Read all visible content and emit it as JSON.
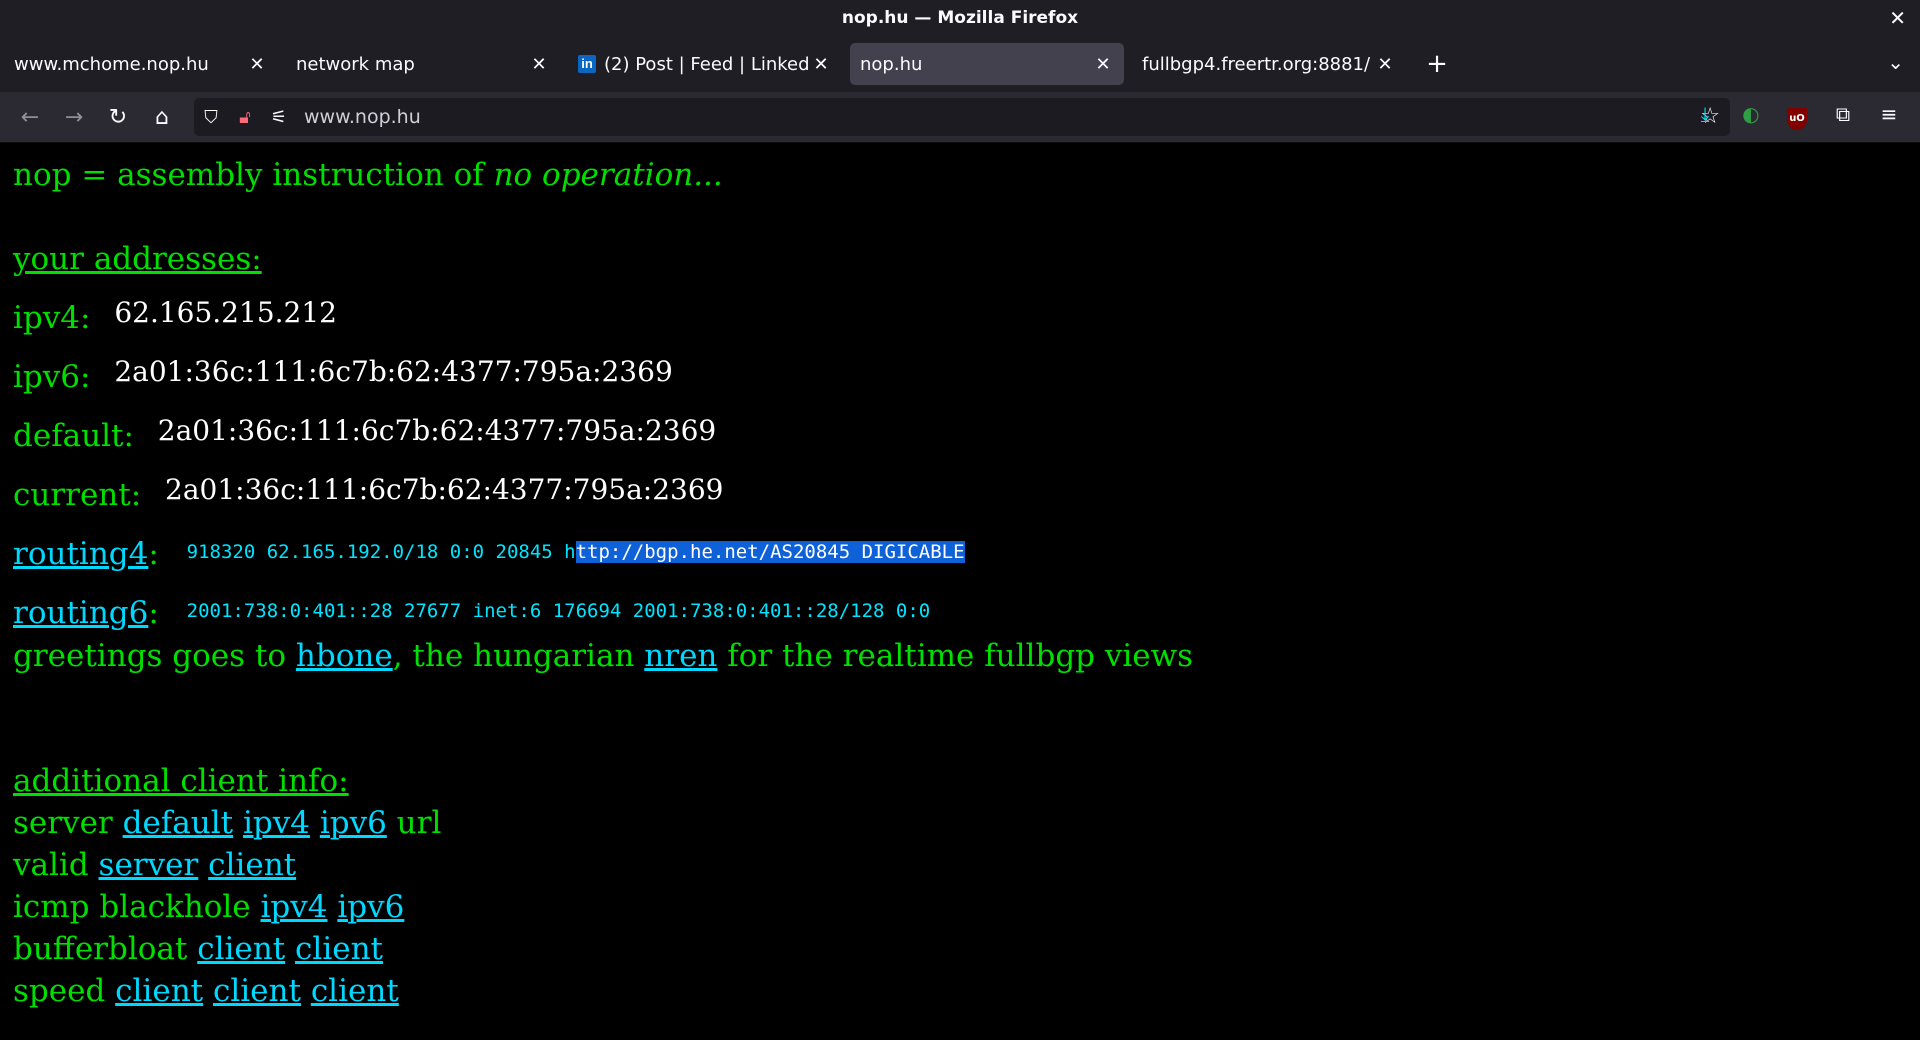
{
  "window": {
    "title": "nop.hu — Mozilla Firefox",
    "close": "✕"
  },
  "tabs": [
    {
      "label": "www.mchome.nop.hu",
      "active": false
    },
    {
      "label": "network map",
      "active": false
    },
    {
      "label": "(2) Post | Feed | LinkedIn",
      "active": false,
      "icon": "linkedin-icon"
    },
    {
      "label": "nop.hu",
      "active": true
    },
    {
      "label": "fullbgp4.freertr.org:8881/",
      "active": false
    }
  ],
  "navbar": {
    "url": "www.nop.hu"
  },
  "page": {
    "intro_text": "nop = assembly instruction of ",
    "intro_em": "no operation...",
    "your_addresses": "your addresses:",
    "ipv4_label": "ipv4:",
    "ipv4_value": "62.165.215.212",
    "ipv6_label": "ipv6:",
    "ipv6_value": "2a01:36c:111:6c7b:62:4377:795a:2369",
    "default_label": "default:",
    "default_value": "2a01:36c:111:6c7b:62:4377:795a:2369",
    "current_label": "current:",
    "current_value": "2a01:36c:111:6c7b:62:4377:795a:2369",
    "routing4_label": "routing4",
    "routing4_value": "918320 62.165.192.0/18 0:0 20845 h",
    "routing4_selected": "ttp://bgp.he.net/AS20845 DIGICABLE",
    "routing6_label": "routing6",
    "routing6_value": "2001:738:0:401::28 27677 inet:6 176694 2001:738:0:401::28/128 0:0",
    "greet_1": "greetings goes to ",
    "greet_link1": "hbone",
    "greet_2": ", the hungarian ",
    "greet_link2": "nren",
    "greet_3": " for the realtime fullbgp views",
    "additional": "additional client info:",
    "server_label": "server ",
    "server_links": [
      "default",
      "ipv4",
      "ipv6"
    ],
    "server_tail": " url",
    "valid_label": "valid ",
    "valid_links": [
      "server",
      "client"
    ],
    "icmp_label": "icmp blackhole ",
    "icmp_links": [
      "ipv4",
      "ipv6"
    ],
    "buffer_label": "bufferbloat ",
    "buffer_links": [
      "client",
      "client"
    ],
    "speed_label": "speed ",
    "speed_links": [
      "client",
      "client",
      "client"
    ]
  }
}
